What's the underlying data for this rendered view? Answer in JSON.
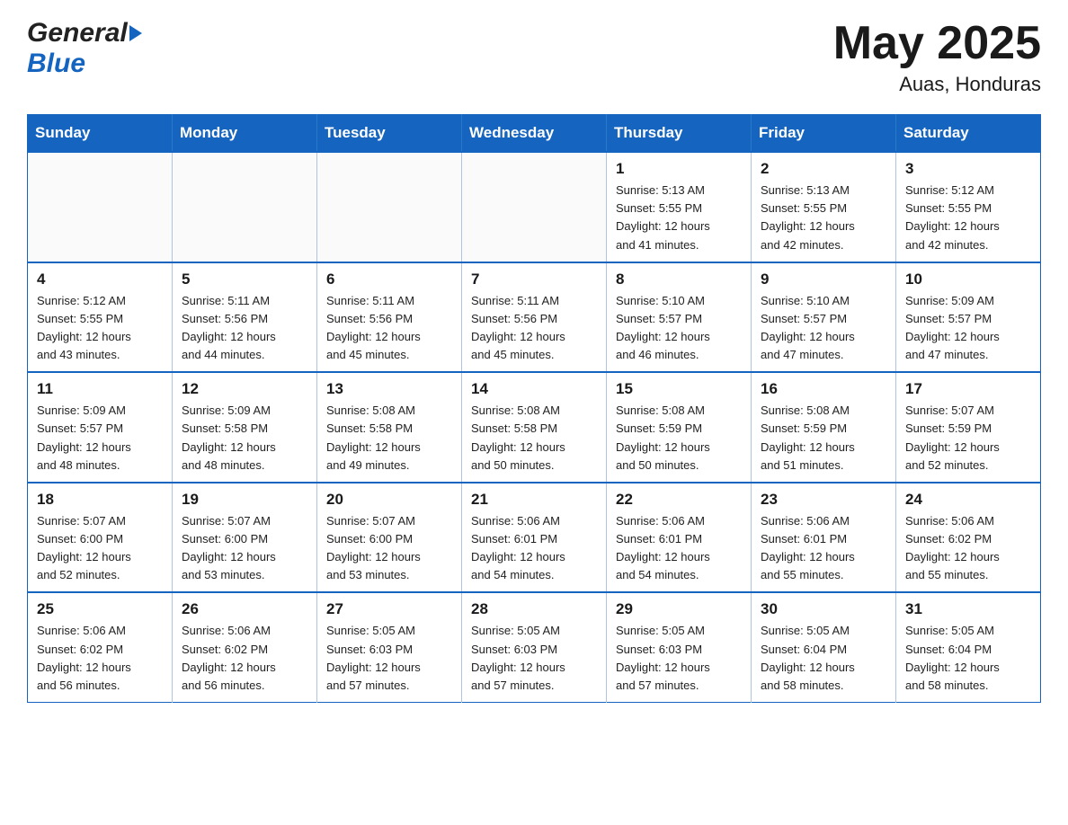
{
  "header": {
    "logo_general": "General",
    "logo_blue": "Blue",
    "month_title": "May 2025",
    "location": "Auas, Honduras"
  },
  "days_of_week": [
    "Sunday",
    "Monday",
    "Tuesday",
    "Wednesday",
    "Thursday",
    "Friday",
    "Saturday"
  ],
  "weeks": [
    [
      {
        "day": "",
        "info": ""
      },
      {
        "day": "",
        "info": ""
      },
      {
        "day": "",
        "info": ""
      },
      {
        "day": "",
        "info": ""
      },
      {
        "day": "1",
        "info": "Sunrise: 5:13 AM\nSunset: 5:55 PM\nDaylight: 12 hours\nand 41 minutes."
      },
      {
        "day": "2",
        "info": "Sunrise: 5:13 AM\nSunset: 5:55 PM\nDaylight: 12 hours\nand 42 minutes."
      },
      {
        "day": "3",
        "info": "Sunrise: 5:12 AM\nSunset: 5:55 PM\nDaylight: 12 hours\nand 42 minutes."
      }
    ],
    [
      {
        "day": "4",
        "info": "Sunrise: 5:12 AM\nSunset: 5:55 PM\nDaylight: 12 hours\nand 43 minutes."
      },
      {
        "day": "5",
        "info": "Sunrise: 5:11 AM\nSunset: 5:56 PM\nDaylight: 12 hours\nand 44 minutes."
      },
      {
        "day": "6",
        "info": "Sunrise: 5:11 AM\nSunset: 5:56 PM\nDaylight: 12 hours\nand 45 minutes."
      },
      {
        "day": "7",
        "info": "Sunrise: 5:11 AM\nSunset: 5:56 PM\nDaylight: 12 hours\nand 45 minutes."
      },
      {
        "day": "8",
        "info": "Sunrise: 5:10 AM\nSunset: 5:57 PM\nDaylight: 12 hours\nand 46 minutes."
      },
      {
        "day": "9",
        "info": "Sunrise: 5:10 AM\nSunset: 5:57 PM\nDaylight: 12 hours\nand 47 minutes."
      },
      {
        "day": "10",
        "info": "Sunrise: 5:09 AM\nSunset: 5:57 PM\nDaylight: 12 hours\nand 47 minutes."
      }
    ],
    [
      {
        "day": "11",
        "info": "Sunrise: 5:09 AM\nSunset: 5:57 PM\nDaylight: 12 hours\nand 48 minutes."
      },
      {
        "day": "12",
        "info": "Sunrise: 5:09 AM\nSunset: 5:58 PM\nDaylight: 12 hours\nand 48 minutes."
      },
      {
        "day": "13",
        "info": "Sunrise: 5:08 AM\nSunset: 5:58 PM\nDaylight: 12 hours\nand 49 minutes."
      },
      {
        "day": "14",
        "info": "Sunrise: 5:08 AM\nSunset: 5:58 PM\nDaylight: 12 hours\nand 50 minutes."
      },
      {
        "day": "15",
        "info": "Sunrise: 5:08 AM\nSunset: 5:59 PM\nDaylight: 12 hours\nand 50 minutes."
      },
      {
        "day": "16",
        "info": "Sunrise: 5:08 AM\nSunset: 5:59 PM\nDaylight: 12 hours\nand 51 minutes."
      },
      {
        "day": "17",
        "info": "Sunrise: 5:07 AM\nSunset: 5:59 PM\nDaylight: 12 hours\nand 52 minutes."
      }
    ],
    [
      {
        "day": "18",
        "info": "Sunrise: 5:07 AM\nSunset: 6:00 PM\nDaylight: 12 hours\nand 52 minutes."
      },
      {
        "day": "19",
        "info": "Sunrise: 5:07 AM\nSunset: 6:00 PM\nDaylight: 12 hours\nand 53 minutes."
      },
      {
        "day": "20",
        "info": "Sunrise: 5:07 AM\nSunset: 6:00 PM\nDaylight: 12 hours\nand 53 minutes."
      },
      {
        "day": "21",
        "info": "Sunrise: 5:06 AM\nSunset: 6:01 PM\nDaylight: 12 hours\nand 54 minutes."
      },
      {
        "day": "22",
        "info": "Sunrise: 5:06 AM\nSunset: 6:01 PM\nDaylight: 12 hours\nand 54 minutes."
      },
      {
        "day": "23",
        "info": "Sunrise: 5:06 AM\nSunset: 6:01 PM\nDaylight: 12 hours\nand 55 minutes."
      },
      {
        "day": "24",
        "info": "Sunrise: 5:06 AM\nSunset: 6:02 PM\nDaylight: 12 hours\nand 55 minutes."
      }
    ],
    [
      {
        "day": "25",
        "info": "Sunrise: 5:06 AM\nSunset: 6:02 PM\nDaylight: 12 hours\nand 56 minutes."
      },
      {
        "day": "26",
        "info": "Sunrise: 5:06 AM\nSunset: 6:02 PM\nDaylight: 12 hours\nand 56 minutes."
      },
      {
        "day": "27",
        "info": "Sunrise: 5:05 AM\nSunset: 6:03 PM\nDaylight: 12 hours\nand 57 minutes."
      },
      {
        "day": "28",
        "info": "Sunrise: 5:05 AM\nSunset: 6:03 PM\nDaylight: 12 hours\nand 57 minutes."
      },
      {
        "day": "29",
        "info": "Sunrise: 5:05 AM\nSunset: 6:03 PM\nDaylight: 12 hours\nand 57 minutes."
      },
      {
        "day": "30",
        "info": "Sunrise: 5:05 AM\nSunset: 6:04 PM\nDaylight: 12 hours\nand 58 minutes."
      },
      {
        "day": "31",
        "info": "Sunrise: 5:05 AM\nSunset: 6:04 PM\nDaylight: 12 hours\nand 58 minutes."
      }
    ]
  ]
}
